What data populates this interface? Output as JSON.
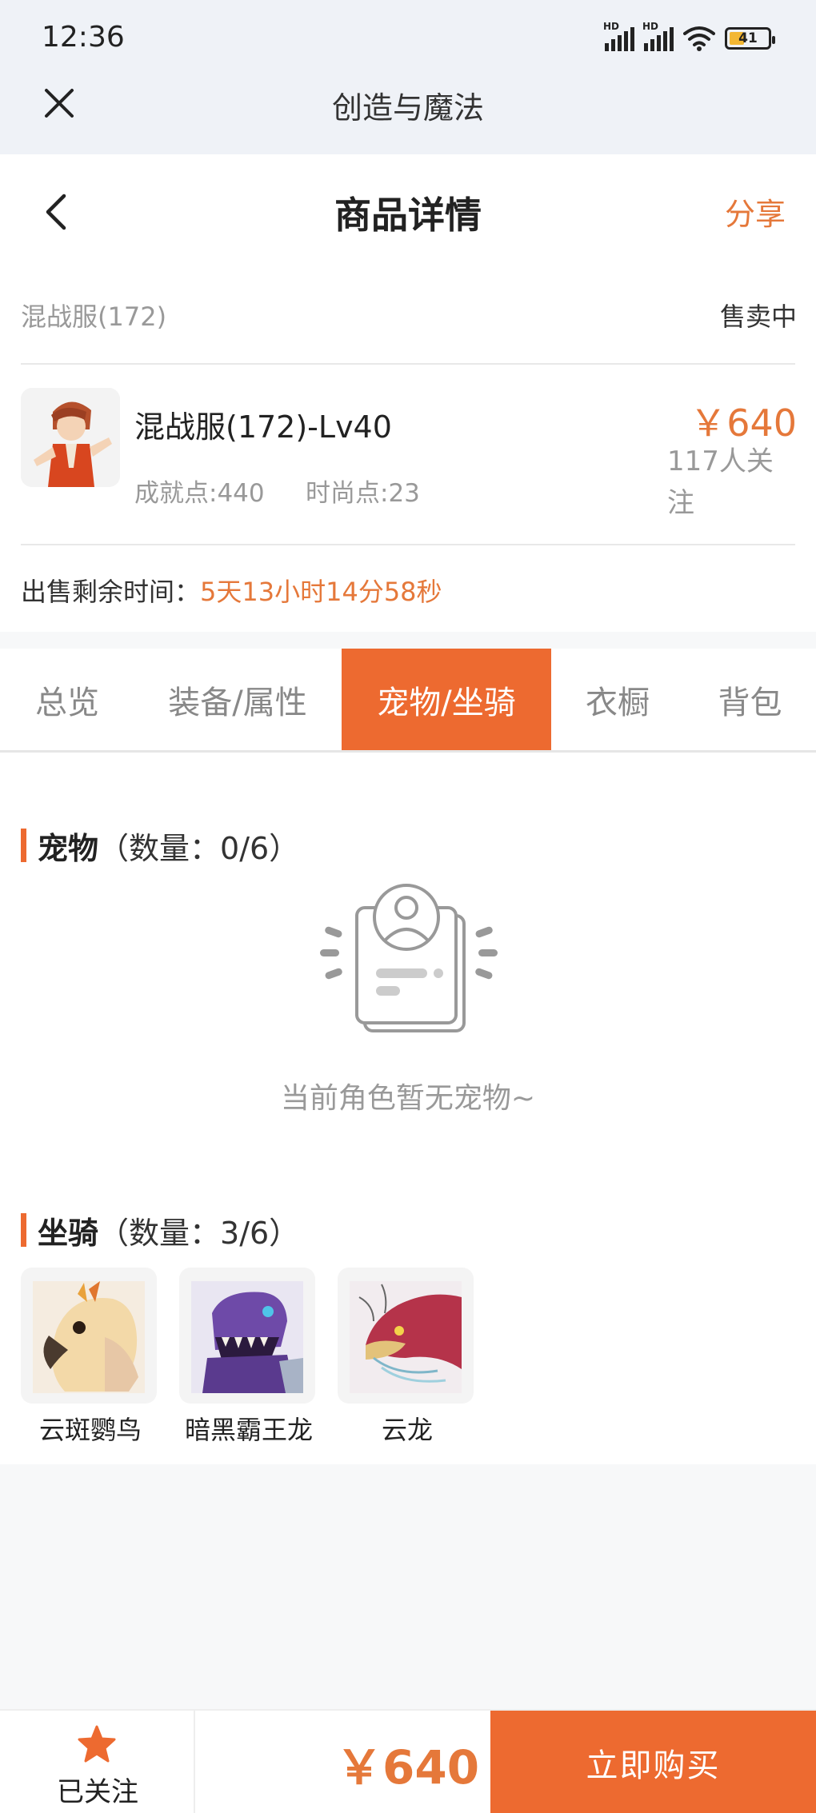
{
  "status_bar": {
    "time": "12:36",
    "hd_label": "HD",
    "battery": "41"
  },
  "app_bar": {
    "title": "创造与魔法"
  },
  "header": {
    "title": "商品详情",
    "share": "分享"
  },
  "product": {
    "server": "混战服(172)",
    "status": "售卖中",
    "name": "混战服(172)-Lv40",
    "achievement": "成就点:440",
    "fashion": "时尚点:23",
    "price": "￥640",
    "followers": "117人关注",
    "remaining_label": "出售剩余时间：",
    "remaining_value": "5天13小时14分58秒"
  },
  "tabs": [
    {
      "label": "总览",
      "active": false
    },
    {
      "label": "装备/属性",
      "active": false
    },
    {
      "label": "宠物/坐骑",
      "active": true
    },
    {
      "label": "衣橱",
      "active": false
    },
    {
      "label": "背包",
      "active": false
    }
  ],
  "pets": {
    "title": "宠物",
    "count": "（数量：0/6）",
    "empty_text": "当前角色暂无宠物~"
  },
  "mounts": {
    "title": "坐骑",
    "count": "（数量：3/6）",
    "items": [
      {
        "name": "云斑鹦鸟",
        "icon": "parrot-mount-icon"
      },
      {
        "name": "暗黑霸王龙",
        "icon": "dark-trex-mount-icon"
      },
      {
        "name": "云龙",
        "icon": "cloud-dragon-mount-icon"
      }
    ]
  },
  "bottom_bar": {
    "followed": "已关注",
    "price": "￥640",
    "buy": "立即购买"
  },
  "colors": {
    "accent": "#ed6a30",
    "price": "#e5783a"
  }
}
